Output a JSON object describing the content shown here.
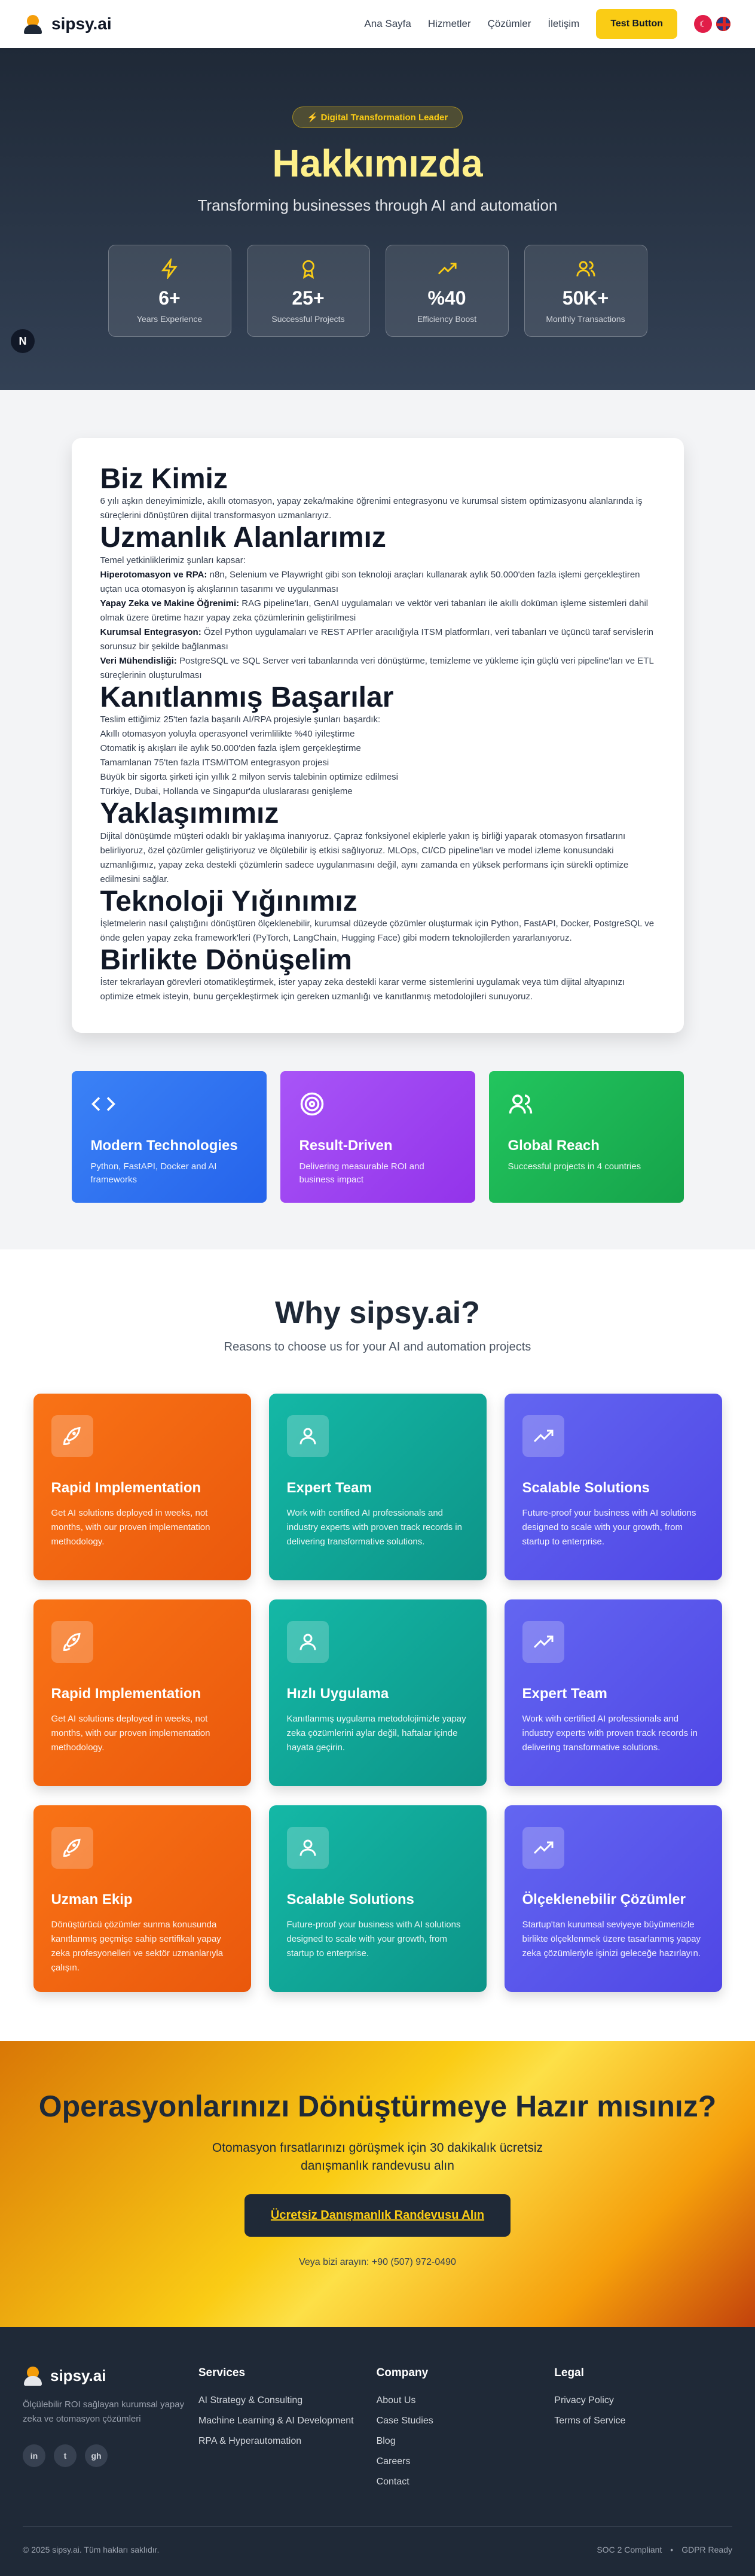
{
  "nav": {
    "brand": "sipsy.ai",
    "links": [
      "Ana Sayfa",
      "Hizmetler",
      "Çözümler",
      "İletişim"
    ],
    "cta": "Test Button"
  },
  "hero": {
    "badge": "⚡ Digital Transformation Leader",
    "title": "Hakkımızda",
    "subtitle": "Transforming businesses through AI and automation",
    "stats": [
      {
        "icon": "lightning-icon",
        "value": "6+",
        "label": "Years Experience"
      },
      {
        "icon": "award-icon",
        "value": "25+",
        "label": "Successful Projects"
      },
      {
        "icon": "trending-up-icon",
        "value": "%40",
        "label": "Efficiency Boost"
      },
      {
        "icon": "users-icon",
        "value": "50K+",
        "label": "Monthly Transactions"
      }
    ],
    "floater": "N"
  },
  "about": {
    "h1": "Biz Kimiz",
    "p1": "6 yılı aşkın deneyimimizle, akıllı otomasyon, yapay zeka/makine öğrenimi entegrasyonu ve kurumsal sistem optimizasyonu alanlarında iş süreçlerini dönüştüren dijital transformasyon uzmanlarıyız.",
    "h2": "Uzmanlık Alanlarımız",
    "intro": "Temel yetkinliklerimiz şunları kapsar:",
    "items": [
      {
        "b": "Hiperotomasyon ve RPA:",
        "t": " n8n, Selenium ve Playwright gibi son teknoloji araçları kullanarak aylık 50.000'den fazla işlemi gerçekleştiren uçtan uca otomasyon iş akışlarının tasarımı ve uygulanması"
      },
      {
        "b": "Yapay Zeka ve Makine Öğrenimi:",
        "t": " RAG pipeline'ları, GenAI uygulamaları ve vektör veri tabanları ile akıllı doküman işleme sistemleri dahil olmak üzere üretime hazır yapay zeka çözümlerinin geliştirilmesi"
      },
      {
        "b": "Kurumsal Entegrasyon:",
        "t": " Özel Python uygulamaları ve REST API'ler aracılığıyla ITSM platformları, veri tabanları ve üçüncü taraf servislerin sorunsuz bir şekilde bağlanması"
      },
      {
        "b": "Veri Mühendisliği:",
        "t": " PostgreSQL ve SQL Server veri tabanlarında veri dönüştürme, temizleme ve yükleme için güçlü veri pipeline'ları ve ETL süreçlerinin oluşturulması"
      }
    ],
    "h3": "Kanıtlanmış Başarılar",
    "achIntro": "Teslim ettiğimiz 25'ten fazla başarılı AI/RPA projesiyle şunları başardık:",
    "achievements": [
      "Akıllı otomasyon yoluyla operasyonel verimlilikte %40 iyileştirme",
      "Otomatik iş akışları ile aylık 50.000'den fazla işlem gerçekleştirme",
      "Tamamlanan 75'ten fazla ITSM/ITOM entegrasyon projesi",
      "Büyük bir sigorta şirketi için yıllık 2 milyon servis talebinin optimize edilmesi",
      "Türkiye, Dubai, Hollanda ve Singapur'da uluslararası genişleme"
    ],
    "h4": "Yaklaşımımız",
    "p4": "Dijital dönüşümde müşteri odaklı bir yaklaşıma inanıyoruz. Çapraz fonksiyonel ekiplerle yakın iş birliği yaparak otomasyon fırsatlarını belirliyoruz, özel çözümler geliştiriyoruz ve ölçülebilir iş etkisi sağlıyoruz. MLOps, CI/CD pipeline'ları ve model izleme konusundaki uzmanlığımız, yapay zeka destekli çözümlerin sadece uygulanmasını değil, aynı zamanda en yüksek performans için sürekli optimize edilmesini sağlar.",
    "h5": "Teknoloji Yığınımız",
    "p5": "İşletmelerin nasıl çalıştığını dönüştüren ölçeklenebilir, kurumsal düzeyde çözümler oluşturmak için Python, FastAPI, Docker, PostgreSQL ve önde gelen yapay zeka framework'leri (PyTorch, LangChain, Hugging Face) gibi modern teknolojilerden yararlanıyoruz.",
    "h6": "Birlikte Dönüşelim",
    "p6": "İster tekrarlayan görevleri otomatikleştirmek, ister yapay zeka destekli karar verme sistemlerini uygulamak veya tüm dijital altyapınızı optimize etmek isteyin, bunu gerçekleştirmek için gereken uzmanlığı ve kanıtlanmış metodolojileri sunuyoruz."
  },
  "features": [
    {
      "icon": "code-icon",
      "title": "Modern Technologies",
      "desc": "Python, FastAPI, Docker and AI frameworks"
    },
    {
      "icon": "target-icon",
      "title": "Result-Driven",
      "desc": "Delivering measurable ROI and business impact"
    },
    {
      "icon": "users-icon",
      "title": "Global Reach",
      "desc": "Successful projects in 4 countries"
    }
  ],
  "why": {
    "title": "Why sipsy.ai?",
    "subtitle": "Reasons to choose us for your AI and automation projects",
    "tiles": [
      {
        "color": "orange",
        "icon": "rocket-icon",
        "title": "Rapid Implementation",
        "desc": "Get AI solutions deployed in weeks, not months, with our proven implementation methodology."
      },
      {
        "color": "teal",
        "icon": "user-icon",
        "title": "Expert Team",
        "desc": "Work with certified AI professionals and industry experts with proven track records in delivering transformative solutions."
      },
      {
        "color": "indigo",
        "icon": "trending-up-icon",
        "title": "Scalable Solutions",
        "desc": "Future-proof your business with AI solutions designed to scale with your growth, from startup to enterprise."
      },
      {
        "color": "orange",
        "icon": "rocket-icon",
        "title": "Rapid Implementation",
        "desc": "Get AI solutions deployed in weeks, not months, with our proven implementation methodology."
      },
      {
        "color": "teal",
        "icon": "user-icon",
        "title": "Hızlı Uygulama",
        "desc": "Kanıtlanmış uygulama metodolojimizle yapay zeka çözümlerini aylar değil, haftalar içinde hayata geçirin."
      },
      {
        "color": "indigo",
        "icon": "trending-up-icon",
        "title": "Expert Team",
        "desc": "Work with certified AI professionals and industry experts with proven track records in delivering transformative solutions."
      },
      {
        "color": "orange",
        "icon": "rocket-icon",
        "title": "Uzman Ekip",
        "desc": "Dönüştürücü çözümler sunma konusunda kanıtlanmış geçmişe sahip sertifikalı yapay zeka profesyonelleri ve sektör uzmanlarıyla çalışın."
      },
      {
        "color": "teal",
        "icon": "user-icon",
        "title": "Scalable Solutions",
        "desc": "Future-proof your business with AI solutions designed to scale with your growth, from startup to enterprise."
      },
      {
        "color": "indigo",
        "icon": "trending-up-icon",
        "title": "Ölçeklenebilir Çözümler",
        "desc": "Startup'tan kurumsal seviyeye büyümenizle birlikte ölçeklenmek üzere tasarlanmış yapay zeka çözümleriyle işinizi geleceğe hazırlayın."
      }
    ]
  },
  "cta": {
    "title": "Operasyonlarınızı Dönüştürmeye Hazır mısınız?",
    "subtitle": "Otomasyon fırsatlarınızı görüşmek için 30 dakikalık ücretsiz danışmanlık randevusu alın",
    "button": "Ücretsiz Danışmanlık Randevusu Alın",
    "phone": "Veya bizi arayın: +90 (507) 972-0490"
  },
  "footer": {
    "brand": "sipsy.ai",
    "desc": "Ölçülebilir ROI sağlayan kurumsal yapay zeka ve otomasyon çözümleri",
    "socials": [
      {
        "icon": "linkedin-icon",
        "glyph": "in"
      },
      {
        "icon": "twitter-icon",
        "glyph": "t"
      },
      {
        "icon": "github-icon",
        "glyph": "gh"
      }
    ],
    "columns": [
      {
        "title": "Services",
        "links": [
          "AI Strategy & Consulting",
          "Machine Learning & AI Development",
          "RPA & Hyperautomation"
        ]
      },
      {
        "title": "Company",
        "links": [
          "About Us",
          "Case Studies",
          "Blog",
          "Careers",
          "Contact"
        ]
      },
      {
        "title": "Legal",
        "links": [
          "Privacy Policy",
          "Terms of Service"
        ]
      }
    ],
    "copyright": "© 2025 sipsy.ai. Tüm hakları saklıdır.",
    "badges": [
      "SOC 2 Compliant",
      "GDPR Ready"
    ]
  }
}
